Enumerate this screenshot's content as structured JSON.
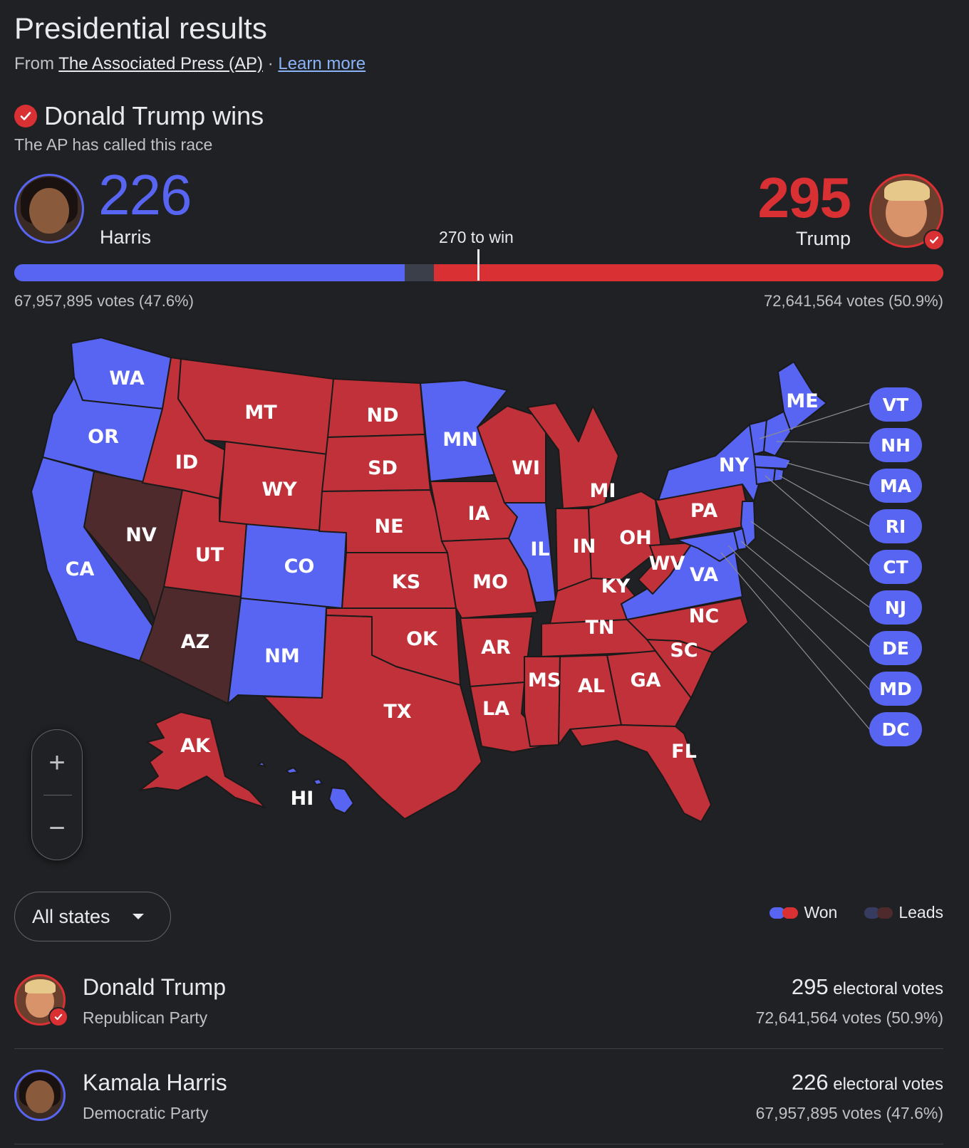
{
  "header": {
    "title": "Presidential results",
    "source_prefix": "From",
    "source_name": "The Associated Press (AP)",
    "separator": "·",
    "learn_more": "Learn more"
  },
  "race": {
    "winner_text": "Donald Trump wins",
    "called_text": "The AP has called this race"
  },
  "harris": {
    "electoral": "226",
    "short_name": "Harris",
    "popular": "67,957,895 votes (47.6%)",
    "color": "#5865f2",
    "electoral_share": 0.4201,
    "full_name": "Kamala Harris",
    "party": "Democratic Party",
    "ev_label": "electoral votes"
  },
  "trump": {
    "electoral": "295",
    "short_name": "Trump",
    "popular": "72,641,564 votes (50.9%)",
    "color": "#d93034",
    "electoral_share": 0.5483,
    "full_name": "Donald Trump",
    "party": "Republican Party",
    "ev_label": "electoral votes"
  },
  "threshold": {
    "label": "270 to win",
    "share": 0.5019
  },
  "map": {
    "colors": {
      "dem_won": "#5865f2",
      "rep_won": "#c0313a",
      "dem_leads": "#353c60",
      "rep_leads": "#4e2a2d",
      "border": "#1a1a1a"
    },
    "states": {
      "WA": "WA",
      "OR": "OR",
      "CA": "CA",
      "NV": "NV",
      "ID": "ID",
      "MT": "MT",
      "WY": "WY",
      "UT": "UT",
      "AZ": "AZ",
      "CO": "CO",
      "NM": "NM",
      "ND": "ND",
      "SD": "SD",
      "NE": "NE",
      "KS": "KS",
      "OK": "OK",
      "TX": "TX",
      "MN": "MN",
      "IA": "IA",
      "MO": "MO",
      "AR": "AR",
      "LA": "LA",
      "WI": "WI",
      "IL": "IL",
      "MI": "MI",
      "IN": "IN",
      "OH": "OH",
      "KY": "KY",
      "TN": "TN",
      "MS": "MS",
      "AL": "AL",
      "GA": "GA",
      "FL": "FL",
      "SC": "SC",
      "NC": "NC",
      "VA": "VA",
      "WV": "WV",
      "PA": "PA",
      "NY": "NY",
      "ME": "ME",
      "AK": "AK",
      "HI": "HI"
    },
    "small_states": [
      "VT",
      "NH",
      "MA",
      "RI",
      "CT",
      "NJ",
      "DE",
      "MD",
      "DC"
    ]
  },
  "zoom": {
    "in": "+",
    "out": "−"
  },
  "filter": {
    "selected": "All states"
  },
  "legend": {
    "won": "Won",
    "leads": "Leads"
  },
  "icons": {
    "check": "check-icon",
    "dropdown": "caret-down-icon"
  }
}
